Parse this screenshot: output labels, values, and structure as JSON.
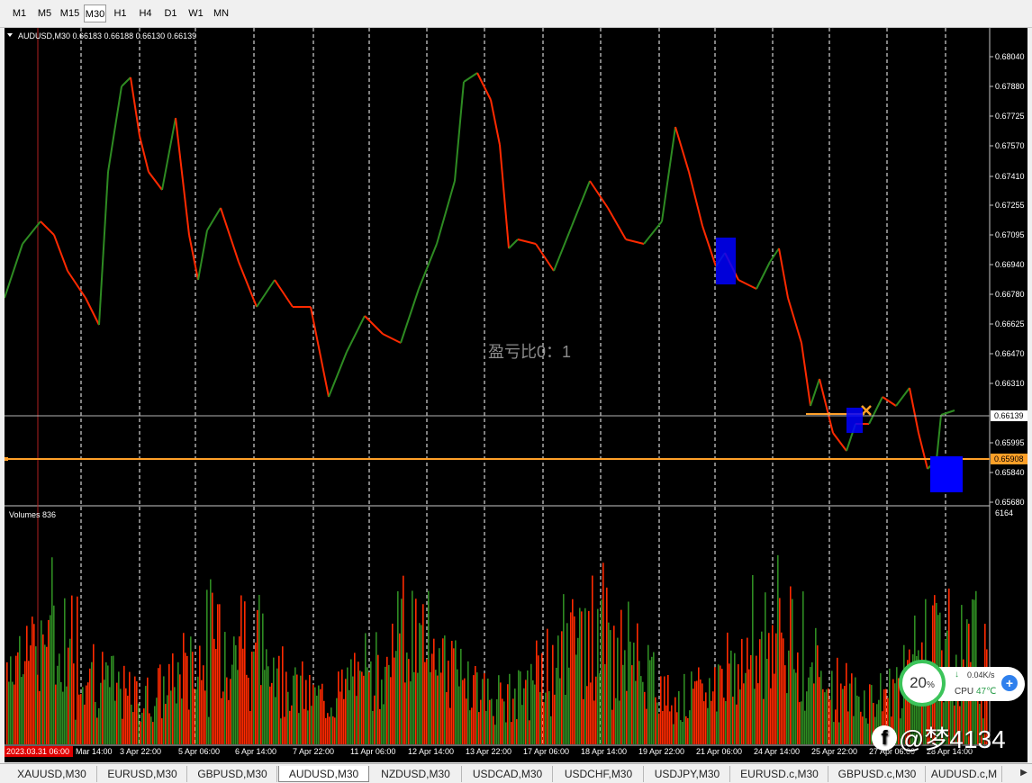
{
  "toolbar": {
    "timeframes": [
      "M1",
      "M5",
      "M15",
      "M30",
      "H1",
      "H4",
      "D1",
      "W1",
      "MN"
    ],
    "active": "M30"
  },
  "chart": {
    "header": "AUDUSD,M30  0.66183 0.66188 0.66130 0.66139",
    "annotation": "盈亏比0：1",
    "price_labels": [
      "0.68040",
      "0.67880",
      "0.67725",
      "0.67570",
      "0.67410",
      "0.67255",
      "0.67095",
      "0.66940",
      "0.66780",
      "0.66625",
      "0.66470",
      "0.66310",
      "0.65995",
      "0.65840",
      "0.65680"
    ],
    "current_price": "0.66139",
    "order_price": "0.65908",
    "volume_label": "Volumes 836",
    "volume_max": "6164",
    "time_labels": [
      "2023.03.31 06:00",
      "Mar 14:00",
      "3 Apr 22:00",
      "5 Apr 06:00",
      "6 Apr 14:00",
      "7 Apr 22:00",
      "11 Apr 06:00",
      "12 Apr 14:00",
      "13 Apr 22:00",
      "17 Apr 06:00",
      "18 Apr 14:00",
      "19 Apr 22:00",
      "21 Apr 06:00",
      "24 Apr 14:00",
      "25 Apr 22:00",
      "27 Apr 06:00",
      "28 Apr 14:00"
    ],
    "colors": {
      "up": "#2e8b22",
      "down": "#ff2a00",
      "order_line": "#ffa028",
      "box": "#0000ff",
      "grid": "#ffffff"
    }
  },
  "tabs": [
    "XAUUSD,M30",
    "EURUSD,M30",
    "GBPUSD,M30",
    "AUDUSD,M30",
    "NZDUSD,M30",
    "USDCAD,M30",
    "USDCHF,M30",
    "USDJPY,M30",
    "EURUSD.c,M30",
    "GBPUSD.c,M30",
    "AUDUSD.c,M"
  ],
  "active_tab": "AUDUSD,M30",
  "widget": {
    "cpu_percent": "20",
    "percent_sign": "%",
    "net_speed": "0.04K/s",
    "cpu_label": "CPU",
    "cpu_temp": "47℃"
  },
  "watermark": {
    "text": "@梦4134"
  }
}
